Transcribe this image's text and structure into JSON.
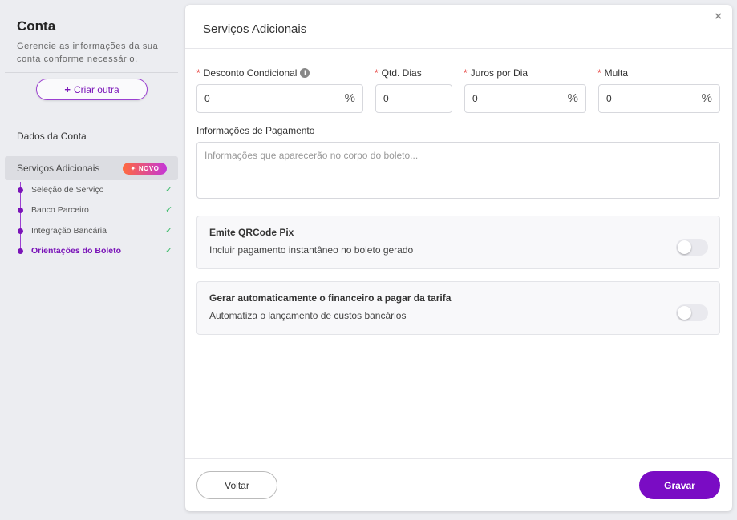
{
  "sidebar": {
    "title": "Conta",
    "description": "Gerencie as informações da sua conta conforme necessário.",
    "create_button": {
      "icon": "+",
      "label": "Criar outra"
    },
    "items": {
      "account_data": "Dados da Conta",
      "additional_services": "Serviços Adicionais",
      "badge": {
        "icon": "✦",
        "label": "NOVO"
      }
    },
    "steps": [
      {
        "label": "Seleção de Serviço",
        "check": "✓"
      },
      {
        "label": "Banco Parceiro",
        "check": "✓"
      },
      {
        "label": "Integração Bancária",
        "check": "✓"
      },
      {
        "label": "Orientações do Boleto",
        "check": "✓"
      }
    ]
  },
  "panel": {
    "close": "×",
    "title": "Serviços Adicionais",
    "fields": {
      "required_mark": "*",
      "discount": {
        "label": "Desconto Condicional",
        "value": "0",
        "suffix": "%",
        "info": "i"
      },
      "days": {
        "label": "Qtd. Dias",
        "value": "0"
      },
      "interest": {
        "label": "Juros por Dia",
        "value": "0",
        "suffix": "%"
      },
      "fine": {
        "label": "Multa",
        "value": "0",
        "suffix": "%"
      }
    },
    "payment_info": {
      "label": "Informações de Pagamento",
      "placeholder": "Informações que aparecerão no corpo do boleto..."
    },
    "toggles": [
      {
        "title": "Emite QRCode Pix",
        "subtitle": "Incluir pagamento instantâneo no boleto gerado",
        "on": false
      },
      {
        "title": "Gerar automaticamente o financeiro a pagar da tarifa",
        "subtitle": "Automatiza o lançamento de custos bancários",
        "on": false
      }
    ],
    "footer": {
      "back": "Voltar",
      "save": "Gravar"
    }
  },
  "colors": {
    "accent": "#7a0cc4",
    "check": "#3bbb6a",
    "required": "#e53935"
  }
}
